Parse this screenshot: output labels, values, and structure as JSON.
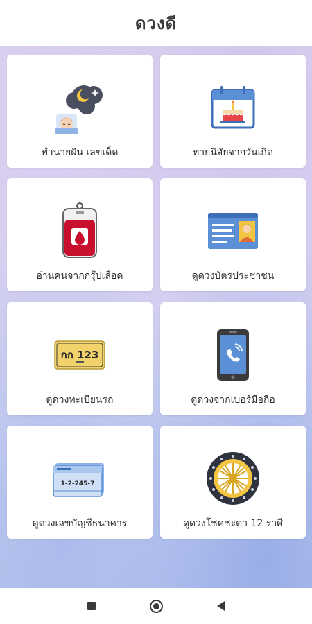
{
  "app": {
    "title": "ดวงดี"
  },
  "menu": [
    {
      "label": "ทำนายฝัน เลขเด็ด",
      "icon": "dream-sleep-icon"
    },
    {
      "label": "ทายนิสัยจากวันเกิด",
      "icon": "birthday-calendar-icon"
    },
    {
      "label": "อ่านคนจากกรุ๊ปเลือด",
      "icon": "blood-bag-icon"
    },
    {
      "label": "ดูดวงบัตรประชาชน",
      "icon": "id-card-icon"
    },
    {
      "label": "ดูดวงทะเบียนรถ",
      "icon": "license-plate-icon"
    },
    {
      "label": "ดูดวงจากเบอร์มือถือ",
      "icon": "mobile-phone-icon"
    },
    {
      "label": "ดูดวงเลขบัญชีธนาคาร",
      "icon": "bank-book-icon"
    },
    {
      "label": "ดูดวงโชคชะตา 12 ราศี",
      "icon": "zodiac-wheel-icon"
    }
  ],
  "plate": {
    "text": "กก 123"
  },
  "bankbook": {
    "number": "1-2-245-7"
  },
  "colors": {
    "accent_blue": "#5b8fd6",
    "blood_red": "#c8102e",
    "plate_yellow": "#f2d26b"
  },
  "navbar": {
    "recent": "square-recents-icon",
    "home": "circle-home-icon",
    "back": "triangle-back-icon"
  }
}
